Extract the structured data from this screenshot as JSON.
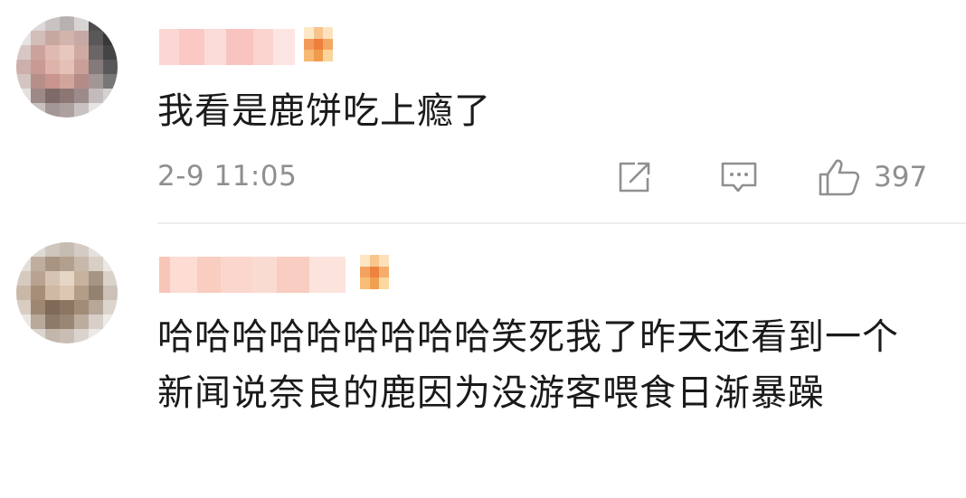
{
  "comments": [
    {
      "text": "我看是鹿饼吃上瘾了",
      "time": "2-9 11:05",
      "likes": "397",
      "icons": [
        "share-icon",
        "reply-icon",
        "like-icon"
      ]
    },
    {
      "text": "哈哈哈哈哈哈哈哈哈笑死我了昨天还看到一个新闻说奈良的鹿因为没游客喂食日渐暴躁"
    }
  ],
  "colors": {
    "text": "#1a1a1a",
    "meta": "#8f8f8f",
    "divider": "#ececec",
    "background": "#ffffff"
  }
}
